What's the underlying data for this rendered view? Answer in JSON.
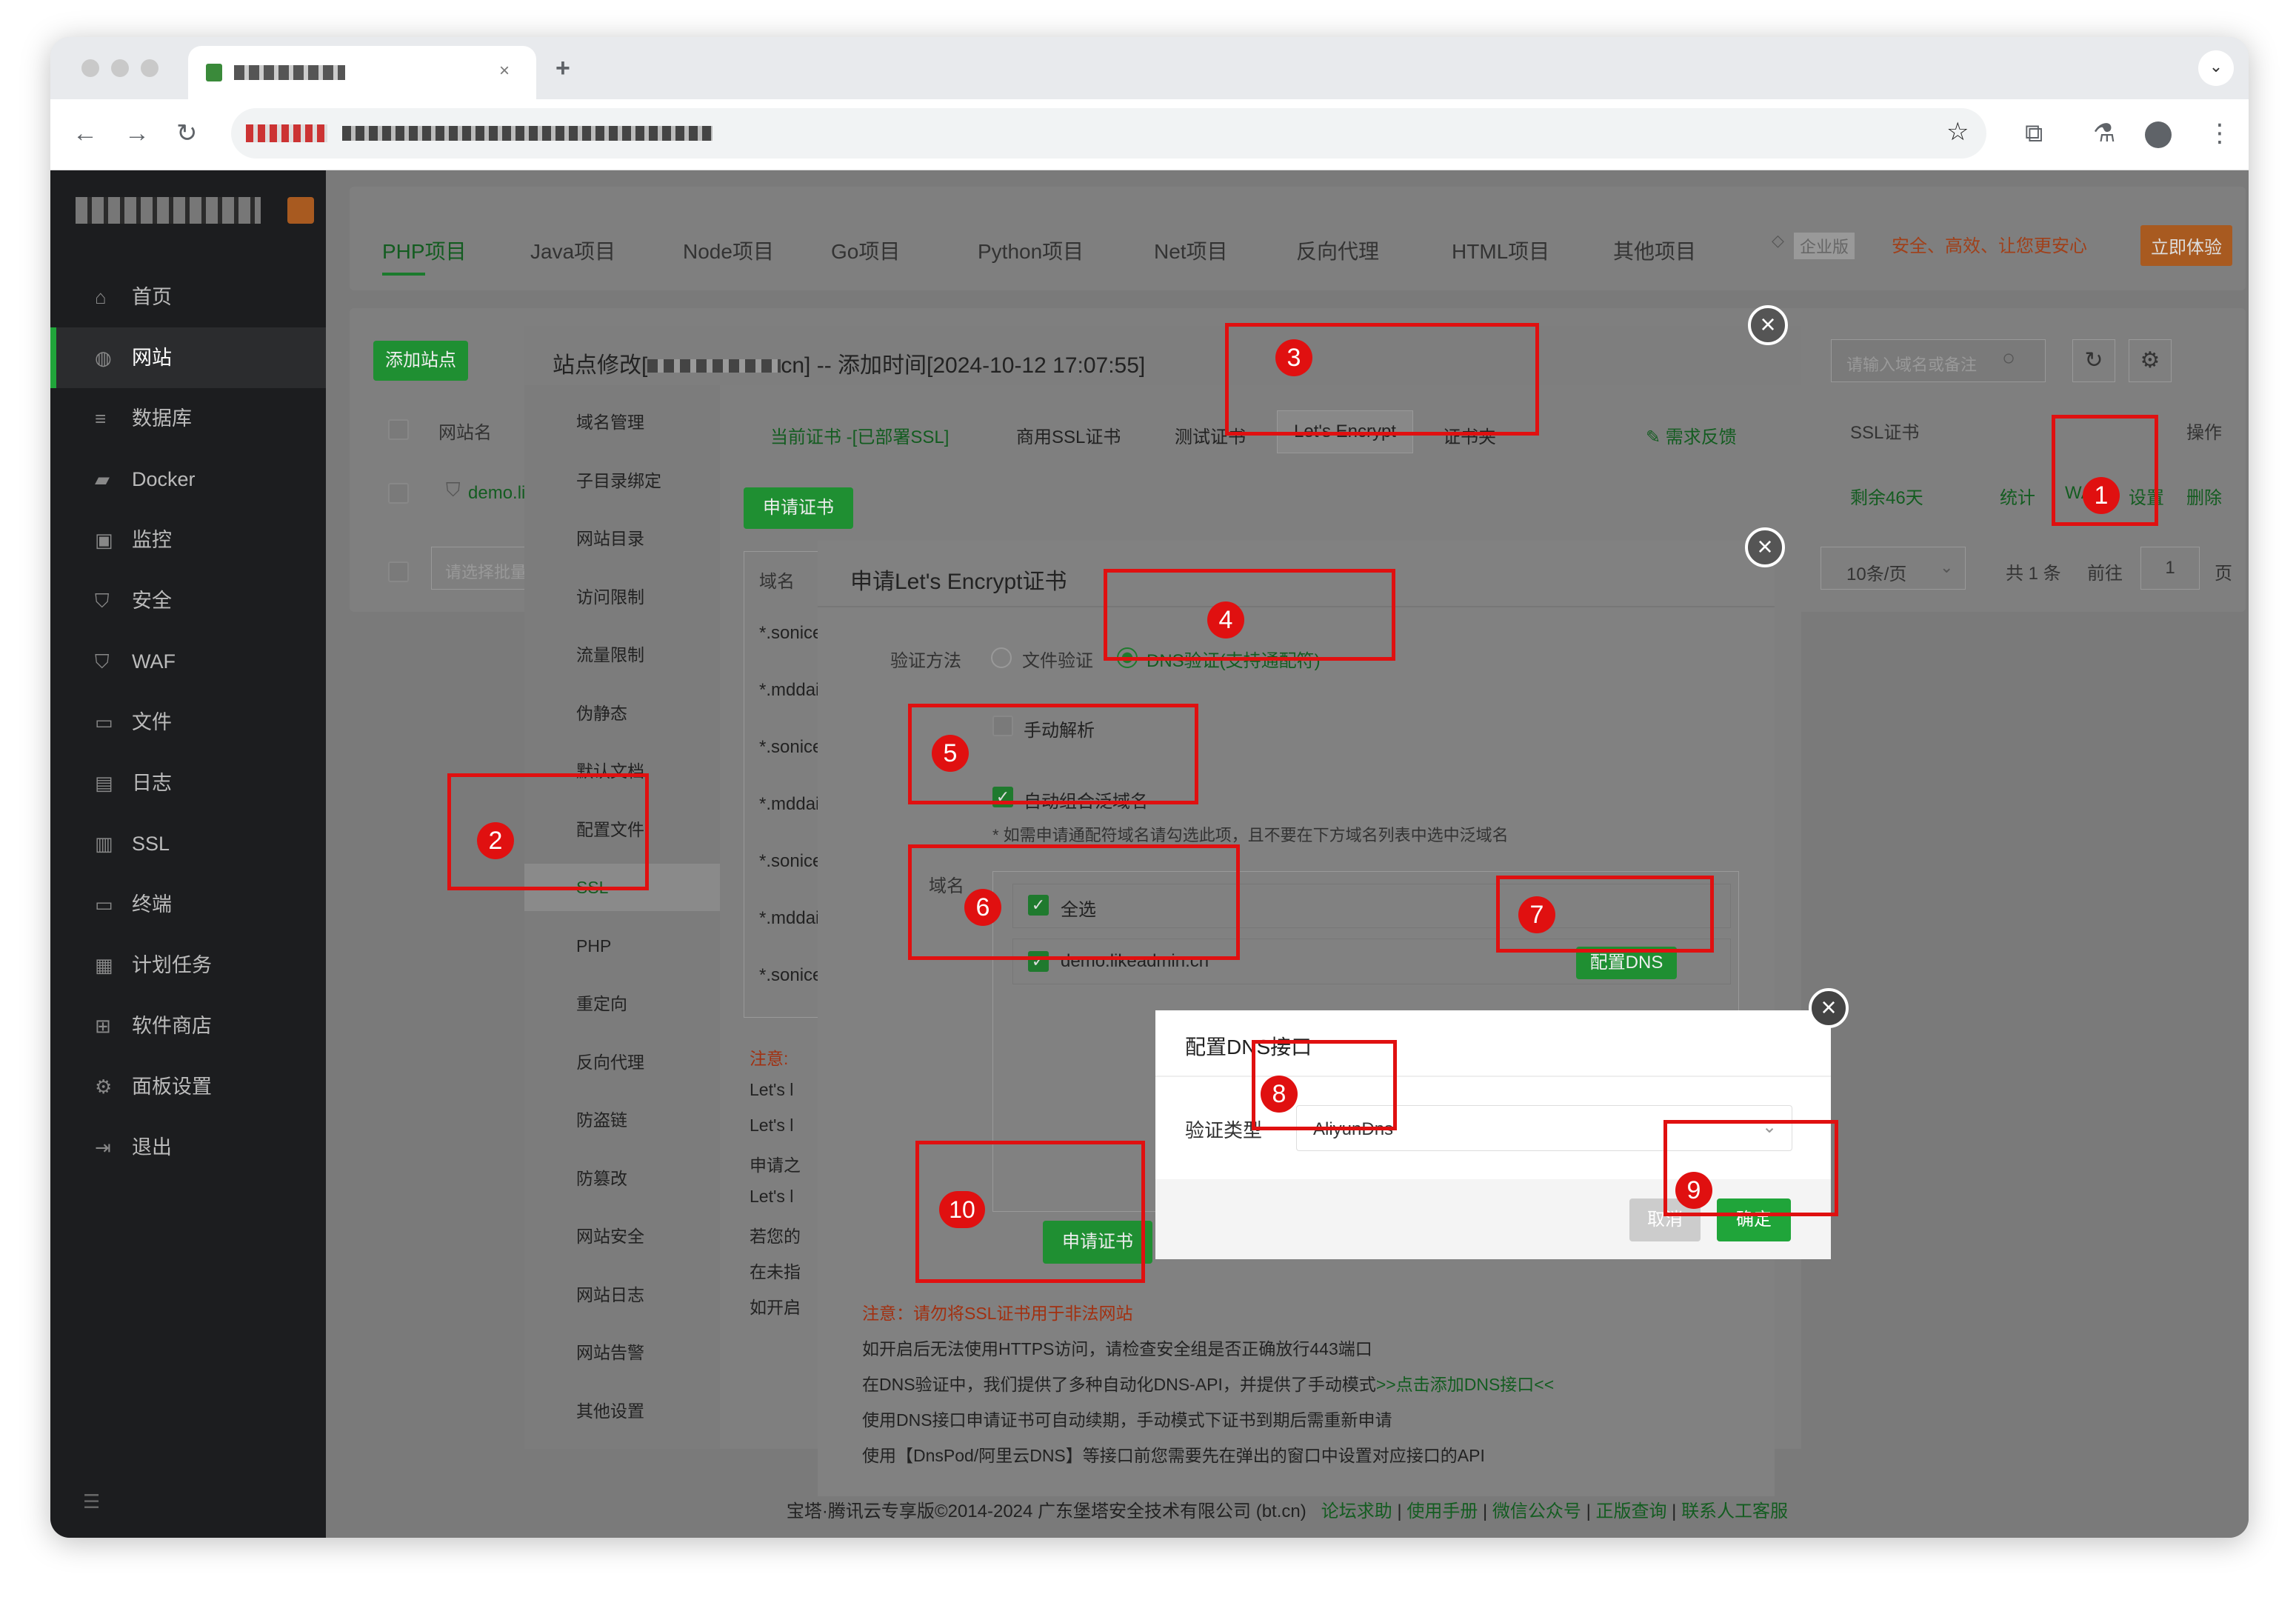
{
  "browser": {
    "icons": {
      "back": "back-arrow-icon",
      "forward": "forward-arrow-icon",
      "reload": "reload-icon",
      "new_tab": "plus-icon",
      "bookmark": "star-icon",
      "extensions": "puzzle-icon",
      "labs": "flask-icon",
      "profile": "profile-icon",
      "menu": "kebab-menu-icon",
      "tab_search": "chevron-down-icon"
    }
  },
  "sidebar": {
    "items": [
      {
        "label": "首页",
        "icon": "home-icon"
      },
      {
        "label": "网站",
        "icon": "globe-icon"
      },
      {
        "label": "数据库",
        "icon": "database-icon"
      },
      {
        "label": "Docker",
        "icon": "docker-icon"
      },
      {
        "label": "监控",
        "icon": "monitor-icon"
      },
      {
        "label": "安全",
        "icon": "shield-icon"
      },
      {
        "label": "WAF",
        "icon": "waf-shield-icon"
      },
      {
        "label": "文件",
        "icon": "folder-icon"
      },
      {
        "label": "日志",
        "icon": "log-icon"
      },
      {
        "label": "SSL",
        "icon": "ssl-icon"
      },
      {
        "label": "终端",
        "icon": "terminal-icon"
      },
      {
        "label": "计划任务",
        "icon": "schedule-icon"
      },
      {
        "label": "软件商店",
        "icon": "grid-icon"
      },
      {
        "label": "面板设置",
        "icon": "gear-icon"
      },
      {
        "label": "退出",
        "icon": "exit-icon"
      }
    ],
    "active_index": 1
  },
  "project_tabs": [
    "PHP项目",
    "Java项目",
    "Node项目",
    "Go项目",
    "Python项目",
    "Net项目",
    "反向代理",
    "HTML项目",
    "其他项目"
  ],
  "promo": {
    "badge": "企业版",
    "text": "安全、高效、让您更安心",
    "button": "立即体验"
  },
  "site_list": {
    "add_button": "添加站点",
    "search_placeholder": "请输入域名或备注",
    "col_name": "网站名",
    "col_ssl": "SSL证书",
    "col_ops": "操作",
    "row": {
      "name": "demo.li",
      "ssl": "剩余46天",
      "ops": [
        "统计",
        "WAF",
        "设置",
        "删除"
      ]
    },
    "batch_placeholder": "请选择批量",
    "page_size": "10条/页",
    "total": "共 1 条",
    "goto_label": "前往",
    "page": "1",
    "page_suffix": "页"
  },
  "site_modal": {
    "title": "站点修改[",
    "title_rest": "cn] -- 添加时间[2024-10-12 17:07:55]",
    "menu": [
      "域名管理",
      "子目录绑定",
      "网站目录",
      "访问限制",
      "流量限制",
      "伪静态",
      "默认文档",
      "配置文件",
      "SSL",
      "PHP",
      "重定向",
      "反向代理",
      "防盗链",
      "防篡改",
      "网站安全",
      "网站日志",
      "网站告警",
      "其他设置"
    ],
    "active_menu": 8,
    "ssl_tabs": [
      "当前证书 -[已部署SSL]",
      "商用SSL证书",
      "测试证书",
      "Let's Encrypt",
      "证书夹"
    ],
    "feedback": "需求反馈",
    "apply_button": "申请证书",
    "col_domain": "域名",
    "domain_rows": [
      "*.sonice",
      "*.mddai",
      "*.sonice",
      "*.mddai",
      "*.sonice",
      "*.mddai",
      "*.sonice"
    ],
    "notes_title": "注意:",
    "notes": [
      "Let's l",
      "Let's l",
      "申请之",
      "Let's l",
      "若您的",
      "在未指",
      "如开启"
    ]
  },
  "le_modal": {
    "title": "申请Let's Encrypt证书",
    "verify_label": "验证方法",
    "opt_file": "文件验证",
    "opt_dns": "DNS验证(支持通配符)",
    "manual": "手动解析",
    "auto_wildcard": "自动组合泛域名",
    "hint": "* 如需申请通配符域名请勾选此项，且不要在下方域名列表中选中泛域名",
    "domain_label": "域名",
    "select_all": "全选",
    "domain": "demo.likeadmin.cn",
    "config_dns": "配置DNS",
    "apply": "申请证书",
    "notice_red": "注意：请勿将SSL证书用于非法网站",
    "notices": [
      "如开启后无法使用HTTPS访问，请检查安全组是否正确放行443端口",
      "在DNS验证中，我们提供了多种自动化DNS-API，并提供了手动模式",
      "使用DNS接口申请证书可自动续期，手动模式下证书到期后需重新申请",
      "使用【DnsPod/阿里云DNS】等接口前您需要先在弹出的窗口中设置对应接口的API"
    ],
    "add_dns_link": ">>点击添加DNS接口<<"
  },
  "dns_modal": {
    "title": "配置DNS接口",
    "type_label": "验证类型",
    "type_value": "AliyunDns",
    "cancel": "取消",
    "confirm": "确定"
  },
  "footer": {
    "copyright": "宝塔·腾讯云专享版©2014-2024 广东堡塔安全技术有限公司 (bt.cn)",
    "links": [
      "论坛求助",
      "使用手册",
      "微信公众号",
      "正版查询",
      "联系人工客服"
    ]
  },
  "steps": [
    "1",
    "2",
    "3",
    "4",
    "5",
    "6",
    "7",
    "8",
    "9",
    "10"
  ],
  "colors": {
    "accent": "#20a53a",
    "annotation": "#e01010",
    "sidebar": "#1c1d1f"
  }
}
